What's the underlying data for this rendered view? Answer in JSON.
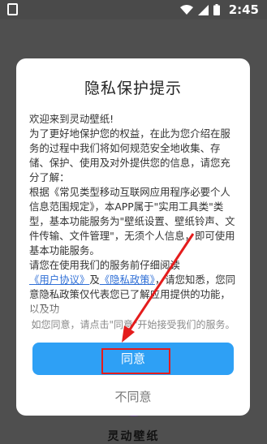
{
  "status_bar": {
    "time": "2:45"
  },
  "backdrop": {
    "app_name": "灵动壁纸"
  },
  "dialog": {
    "title": "隐私保护提示",
    "paragraphs": {
      "welcome": "欢迎来到灵动壁纸!",
      "intro": "为了更好地保护您的权益，在此为您介绍在服务的过程中我们将如何规范安全地收集、存储、保护、使用及对外提供您的信息，请您充分了解：",
      "classification": "根据《常见类型移动互联网应用程序必要个人信息范围规定》，本APP属于\"实用工具类\"类型，基本功能服务为\"壁纸设置、壁纸铃声、文件传输、文件管理\"，无须个人信息，即可使用基本功能服务。",
      "read_prefix": "请您在使用我们的服务前仔细阅读",
      "user_agreement": "《用户协议》",
      "and": "及",
      "privacy_policy": "《隐私政策》",
      "read_suffix": "，请您知悉，您同意隐私政策仅代表您已了解应用提供的功能，以及功"
    },
    "consent_note": "如您同意，请点击\"同意\"开始接受我们的服务。",
    "agree_label": "同意",
    "disagree_label": "不同意"
  },
  "colors": {
    "accent": "#2ea0f5",
    "highlight": "#e41c1c",
    "link": "#2f6fd6"
  }
}
